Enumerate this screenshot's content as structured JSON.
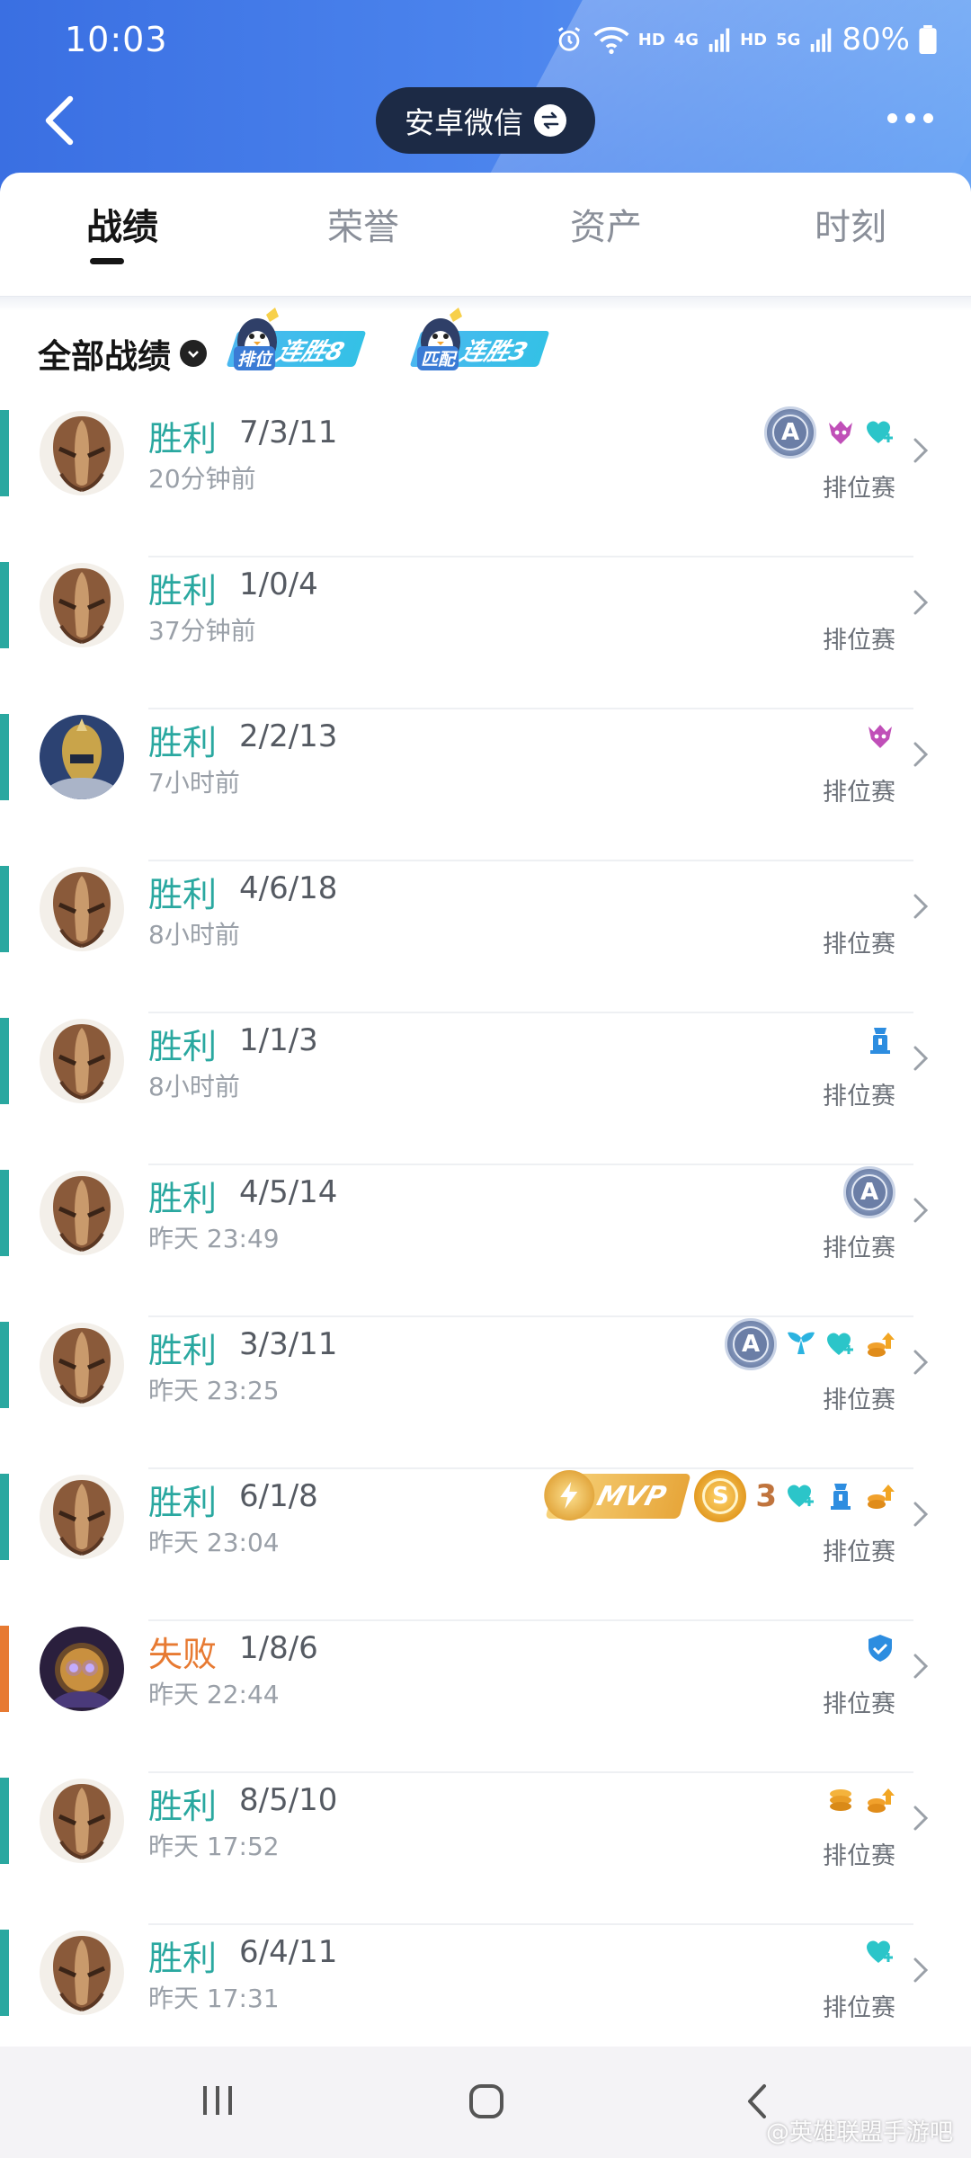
{
  "status_bar": {
    "time": "10:03",
    "battery": "80%",
    "hd1": "HD",
    "net1": "4G",
    "hd2": "HD",
    "net2": "5G"
  },
  "header": {
    "switch_label": "安卓微信"
  },
  "tabs": [
    {
      "label": "战绩",
      "active": true
    },
    {
      "label": "荣誉",
      "active": false
    },
    {
      "label": "资产",
      "active": false
    },
    {
      "label": "时刻",
      "active": false
    }
  ],
  "filter": {
    "label": "全部战绩"
  },
  "streaks": [
    {
      "tag": "排位",
      "text": "连胜8"
    },
    {
      "tag": "匹配",
      "text": "连胜3"
    }
  ],
  "colors": {
    "win": "#2aa8a0",
    "loss": "#e77a32",
    "header_blue": "#4d86ee",
    "pill": "#1c2a45"
  },
  "matches": [
    {
      "result": "胜利",
      "outcome": "win",
      "kda": "7/3/11",
      "time": "20分钟前",
      "mode": "排位赛",
      "hero": "helmet",
      "icons": [
        "grade-a",
        "demon-icon",
        "heart-plus-icon"
      ]
    },
    {
      "result": "胜利",
      "outcome": "win",
      "kda": "1/0/4",
      "time": "37分钟前",
      "mode": "排位赛",
      "hero": "helmet",
      "icons": []
    },
    {
      "result": "胜利",
      "outcome": "win",
      "kda": "2/2/13",
      "time": "7小时前",
      "mode": "排位赛",
      "hero": "knight",
      "icons": [
        "demon-icon"
      ]
    },
    {
      "result": "胜利",
      "outcome": "win",
      "kda": "4/6/18",
      "time": "8小时前",
      "mode": "排位赛",
      "hero": "helmet",
      "icons": []
    },
    {
      "result": "胜利",
      "outcome": "win",
      "kda": "1/1/3",
      "time": "8小时前",
      "mode": "排位赛",
      "hero": "helmet",
      "icons": [
        "tower-icon"
      ]
    },
    {
      "result": "胜利",
      "outcome": "win",
      "kda": "4/5/14",
      "time": "昨天 23:49",
      "mode": "排位赛",
      "hero": "helmet",
      "icons": [
        "grade-a"
      ]
    },
    {
      "result": "胜利",
      "outcome": "win",
      "kda": "3/3/11",
      "time": "昨天 23:25",
      "mode": "排位赛",
      "hero": "helmet",
      "icons": [
        "grade-a",
        "wings-icon",
        "heart-plus-icon",
        "gold-up-icon"
      ]
    },
    {
      "result": "胜利",
      "outcome": "win",
      "kda": "6/1/8",
      "time": "昨天 23:04",
      "mode": "排位赛",
      "hero": "helmet",
      "icons": [
        "mvp-badge",
        "grade-s",
        "count-3",
        "heart-plus-icon",
        "tower-icon",
        "gold-up-icon"
      ],
      "mvp_text": "MVP",
      "count_text": "3"
    },
    {
      "result": "失败",
      "outcome": "loss",
      "kda": "1/8/6",
      "time": "昨天 22:44",
      "mode": "排位赛",
      "hero": "mage",
      "icons": [
        "shield-icon"
      ]
    },
    {
      "result": "胜利",
      "outcome": "win",
      "kda": "8/5/10",
      "time": "昨天 17:52",
      "mode": "排位赛",
      "hero": "helmet",
      "icons": [
        "coins-icon",
        "gold-up-icon"
      ]
    },
    {
      "result": "胜利",
      "outcome": "win",
      "kda": "6/4/11",
      "time": "昨天 17:31",
      "mode": "排位赛",
      "hero": "helmet",
      "icons": [
        "heart-plus-icon"
      ]
    }
  ],
  "watermark": "@英雄联盟手游吧"
}
